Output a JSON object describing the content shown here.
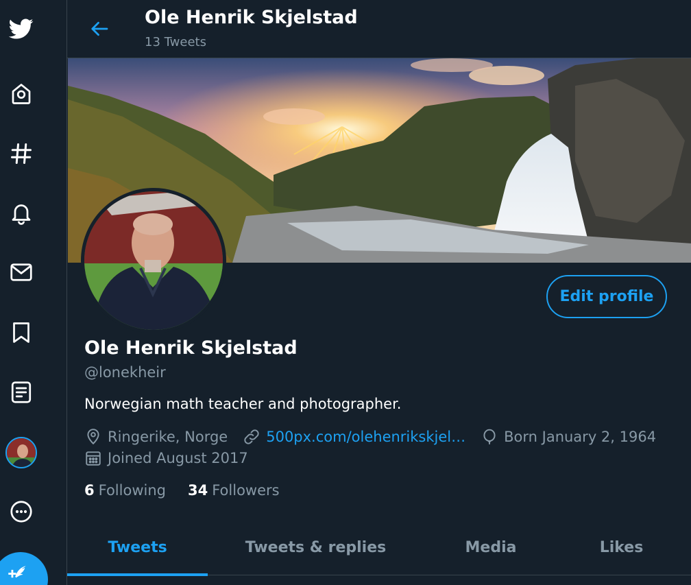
{
  "nav": {
    "items": [
      {
        "name": "twitter-logo-icon"
      },
      {
        "name": "home-icon"
      },
      {
        "name": "explore-hashtag-icon"
      },
      {
        "name": "notifications-bell-icon"
      },
      {
        "name": "messages-envelope-icon"
      },
      {
        "name": "bookmarks-icon"
      },
      {
        "name": "lists-icon"
      },
      {
        "name": "profile-avatar"
      },
      {
        "name": "more-icon"
      },
      {
        "name": "compose-tweet-icon"
      }
    ],
    "accent": "#1da1f2"
  },
  "header": {
    "name": "Ole Henrik Skjelstad",
    "tweet_count": "13 Tweets"
  },
  "profile": {
    "name": "Ole Henrik Skjelstad",
    "handle": "@lonekheir",
    "bio": "Norwegian math teacher and photographer.",
    "edit_label": "Edit profile",
    "location": "Ringerike, Norge",
    "website": "500px.com/olehenrikskjel…",
    "birthday": "Born January 2, 1964",
    "joined": "Joined August 2017",
    "following_count": "6",
    "following_label": "Following",
    "followers_count": "34",
    "followers_label": "Followers"
  },
  "tabs": [
    {
      "label": "Tweets",
      "active": true
    },
    {
      "label": "Tweets & replies",
      "active": false
    },
    {
      "label": "Media",
      "active": false
    },
    {
      "label": "Likes",
      "active": false
    }
  ],
  "colors": {
    "background": "#15202b",
    "border": "#38444d",
    "secondary_text": "#8899a6",
    "accent": "#1da1f2"
  }
}
